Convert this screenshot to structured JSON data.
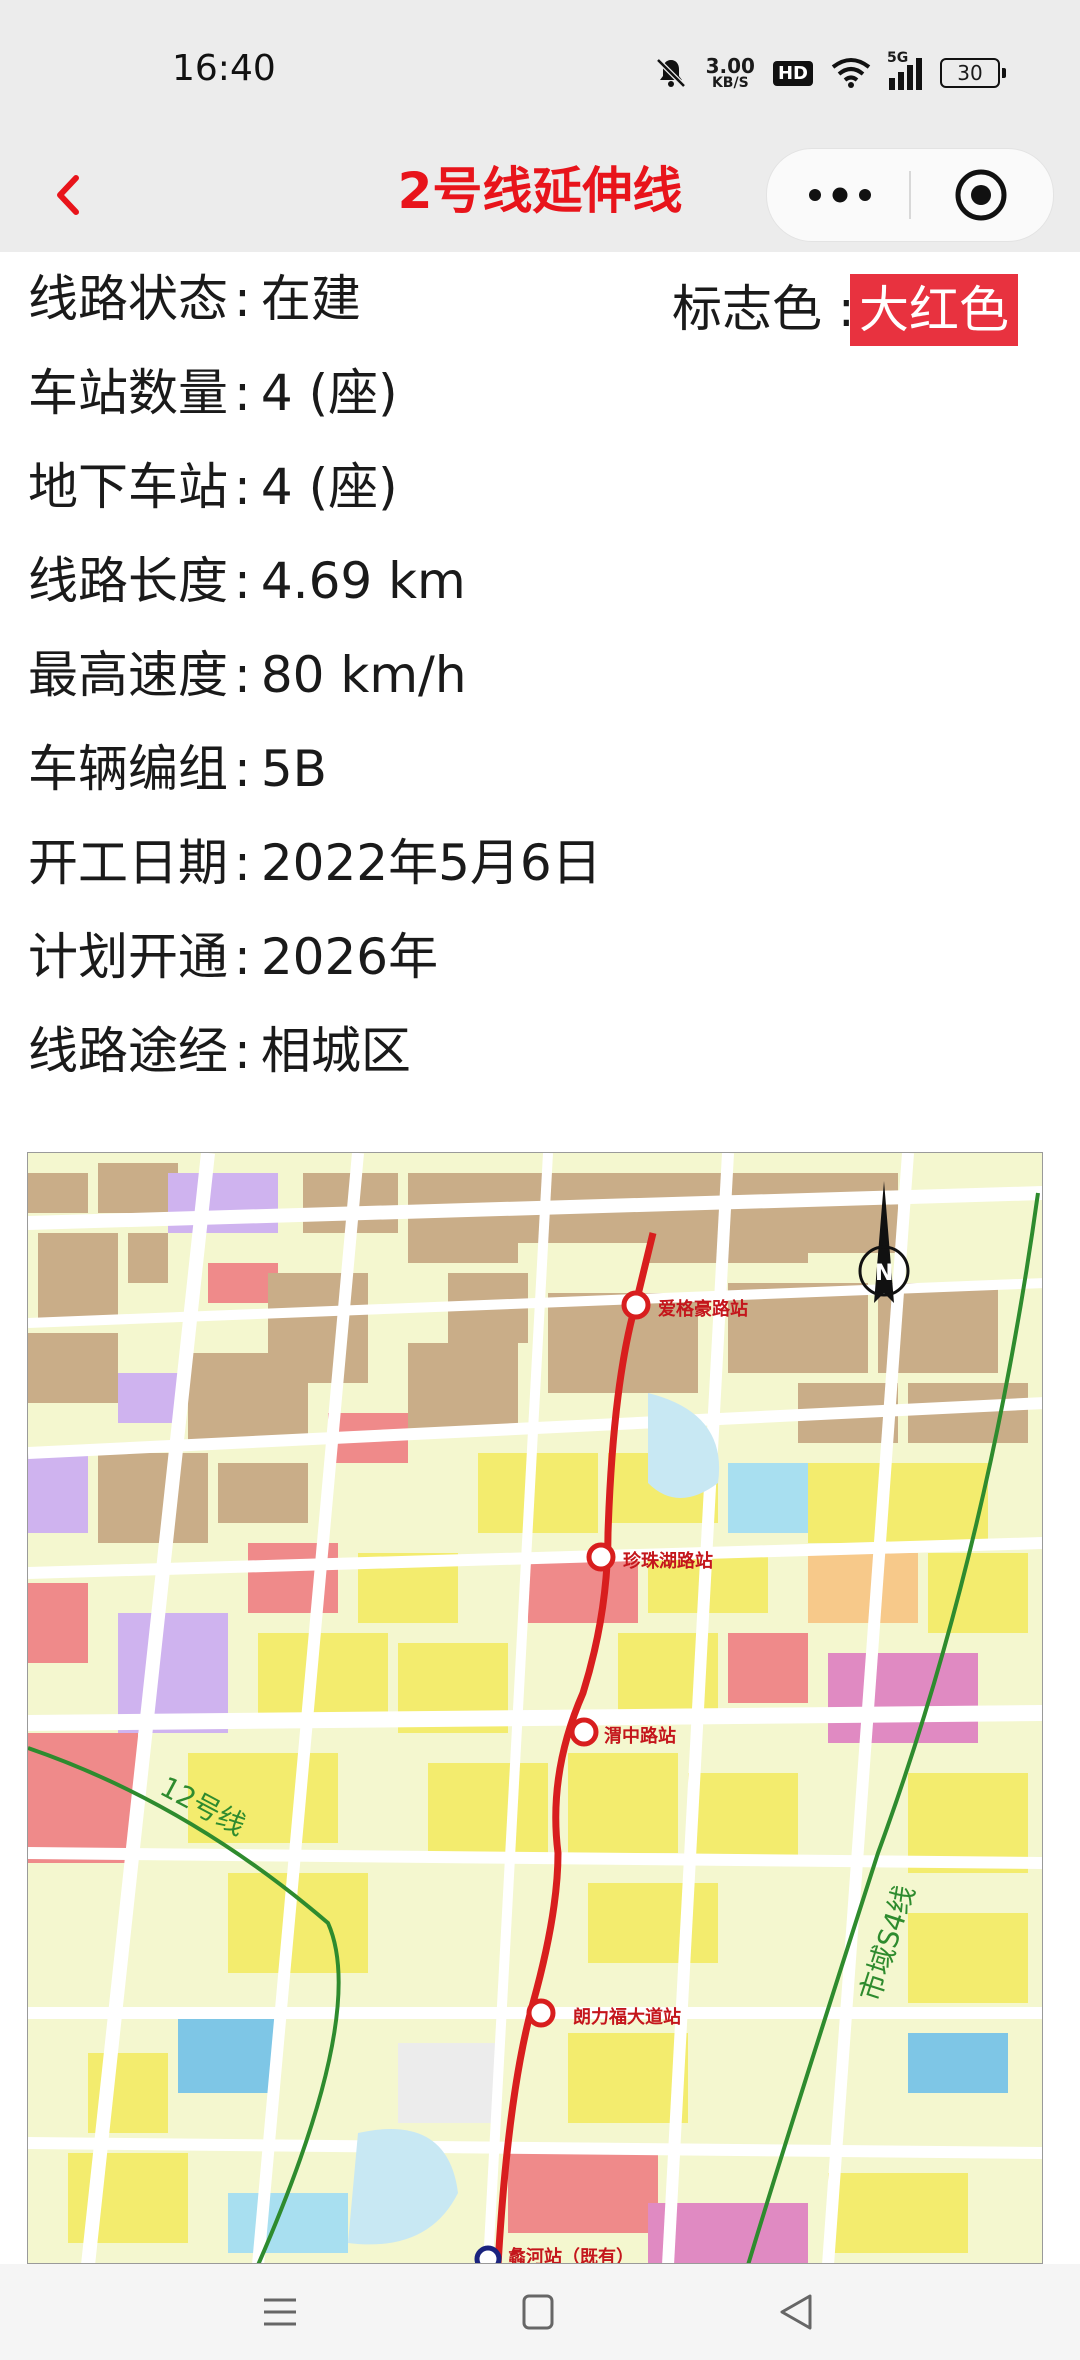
{
  "status_bar": {
    "time": "16:40",
    "net_speed_value": "3.00",
    "net_speed_unit": "KB/S",
    "hd_label": "HD",
    "network_label": "5G",
    "battery_level": "30",
    "icons": [
      "mute-icon",
      "wifi-icon",
      "signal-icon",
      "battery-icon"
    ]
  },
  "header": {
    "title": "2号线延伸线",
    "back_icon": "chevron-left-icon",
    "more_icon": "more-dots-icon",
    "target_icon": "target-icon"
  },
  "info": {
    "rows": [
      {
        "label": "线路状态",
        "value": "在建"
      },
      {
        "label": "车站数量",
        "value": "4 (座)"
      },
      {
        "label": "地下车站",
        "value": "4 (座)"
      },
      {
        "label": "线路长度",
        "value": "4.69 km"
      },
      {
        "label": "最高速度",
        "value": "80 km/h"
      },
      {
        "label": "车辆编组",
        "value": "5B"
      },
      {
        "label": "开工日期",
        "value": "2022年5月6日"
      },
      {
        "label": "计划开通",
        "value": "2026年"
      },
      {
        "label": "线路途经",
        "value": "相城区"
      }
    ],
    "separator": ":",
    "color_label": "标志色 :",
    "color_name": "大红色",
    "color_hex": "#e8323f"
  },
  "map": {
    "stations": [
      "爱格豪路站",
      "珍珠湖路站",
      "渭中路站",
      "朗力福大道站",
      "蠡河站（既有）"
    ],
    "line_labels": [
      "12号线",
      "市域S4线"
    ],
    "compass_label": "N",
    "line_color": "#d81e1e",
    "other_line_color": "#2e8b2e"
  },
  "bottom_nav": {
    "icons": [
      "menu-icon",
      "home-square-icon",
      "back-triangle-icon"
    ]
  }
}
